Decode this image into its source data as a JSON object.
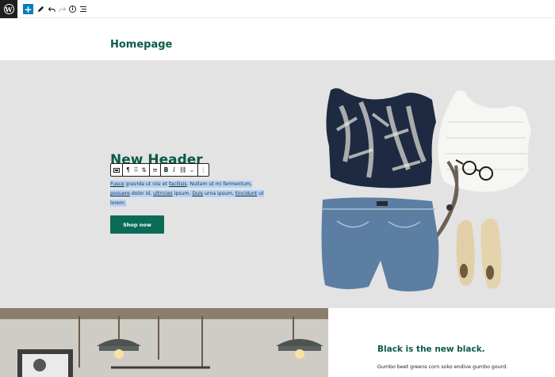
{
  "toolbar": {
    "wp_logo": "W",
    "add_icon": "+",
    "edit_icon": "pencil-icon",
    "undo_icon": "undo-icon",
    "redo_icon": "redo-icon",
    "info_icon": "info-icon",
    "list_view_icon": "list-view-icon"
  },
  "page": {
    "title": "Homepage"
  },
  "hero": {
    "heading": "New Header",
    "paragraph_parts": [
      {
        "text": "Fusce",
        "link": true
      },
      {
        "text": " gravida ut nisi et ",
        "link": false
      },
      {
        "text": "facilisis",
        "link": true
      },
      {
        "text": ". Nullam ut mi fermentum, ",
        "link": false
      },
      {
        "text": "posuere",
        "link": true
      },
      {
        "text": " dolor id, ",
        "link": false
      },
      {
        "text": "ultricies",
        "link": true
      },
      {
        "text": " ipsum. ",
        "link": false
      },
      {
        "text": "Duis",
        "link": true
      },
      {
        "text": " urna ipsum, ",
        "link": false
      },
      {
        "text": "tincidunt",
        "link": true
      },
      {
        "text": " ut lorem.",
        "link": false
      }
    ],
    "button_label": "Shop now",
    "colors": {
      "background": "#e3e3e3",
      "heading": "#0c5a4a",
      "button": "#0c6b56",
      "selection": "#b6d2f2"
    }
  },
  "block_toolbar": {
    "items": [
      {
        "name": "block-type-icon",
        "group": 0
      },
      {
        "name": "paragraph-icon",
        "label": "¶",
        "group": 1
      },
      {
        "name": "drag-handle-icon",
        "label": "⠿",
        "group": 1
      },
      {
        "name": "move-up-down-icon",
        "label": "⇅",
        "group": 1
      },
      {
        "name": "align-left-icon",
        "label": "≡",
        "group": 2
      },
      {
        "name": "bold-icon",
        "label": "B",
        "group": 3
      },
      {
        "name": "italic-icon",
        "label": "I",
        "group": 3
      },
      {
        "name": "link-icon",
        "label": "⛓",
        "group": 3
      },
      {
        "name": "more-formatting-icon",
        "label": "⌄",
        "group": 3
      },
      {
        "name": "more-options-icon",
        "label": "⋮",
        "group": 4
      }
    ]
  },
  "media_text": {
    "heading": "Black is the new black.",
    "body": "Gumbo beet greens corn soko endive gumbo gourd."
  }
}
